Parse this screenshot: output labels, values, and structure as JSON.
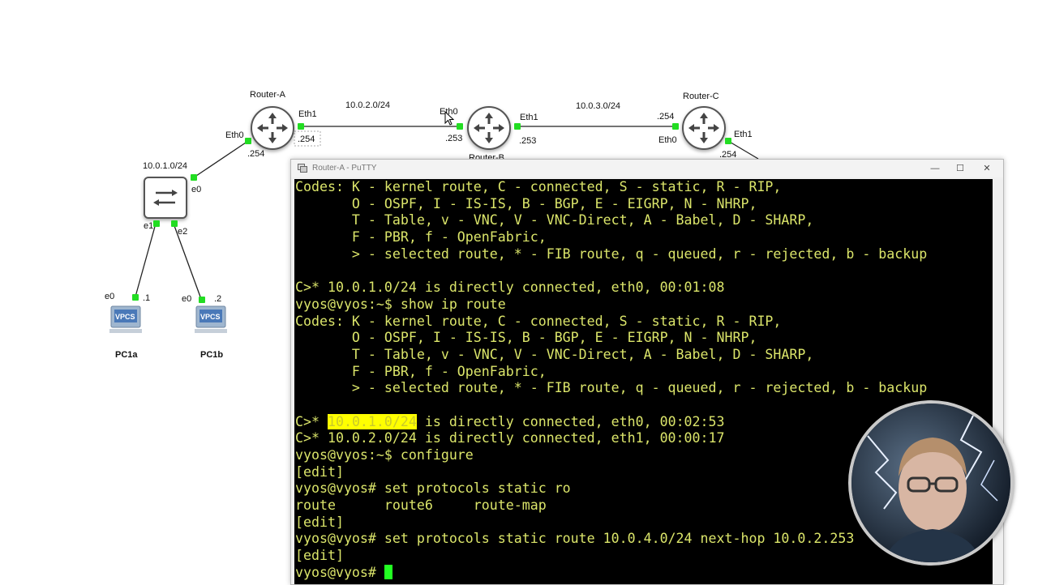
{
  "topology": {
    "routers": [
      {
        "name": "Router-A"
      },
      {
        "name": "Router-B"
      },
      {
        "name": "Router-C"
      }
    ],
    "switch": {
      "name": "switch"
    },
    "pcs": [
      {
        "name": "PC1a",
        "badge": "VPCS"
      },
      {
        "name": "PC1b",
        "badge": "VPCS"
      }
    ],
    "subnets": {
      "net1": "10.0.1.0/24",
      "net2": "10.0.2.0/24",
      "net3": "10.0.3.0/24"
    },
    "interfaces": {
      "ra_eth0": "Eth0",
      "ra_eth1": "Eth1",
      "ra_254a": ".254",
      "ra_254b": ".254",
      "rb_eth0": "Eth0",
      "rb_eth1": "Eth1",
      "rb_253a": ".253",
      "rb_253b": ".253",
      "rc_254": ".254",
      "rc_eth0": "Eth0",
      "rc_eth1": "Eth1",
      "rc_254b": ".254",
      "sw_e0": "e0",
      "sw_e1": "e1",
      "sw_e2": "e2",
      "pc1a_e0": "e0",
      "pc1a_ip": ".1",
      "pc1b_e0": "e0",
      "pc1b_ip": ".2"
    },
    "link_color": "#222222",
    "port_color": "#22dd22"
  },
  "putty": {
    "title": "Router-A - PuTTY",
    "controls": {
      "minimize": "—",
      "maximize": "☐",
      "close": "✕"
    },
    "text_color": "#dbe56a",
    "background": "#000000",
    "lines": [
      "Codes: K - kernel route, C - connected, S - static, R - RIP,",
      "       O - OSPF, I - IS-IS, B - BGP, E - EIGRP, N - NHRP,",
      "       T - Table, v - VNC, V - VNC-Direct, A - Babel, D - SHARP,",
      "       F - PBR, f - OpenFabric,",
      "       > - selected route, * - FIB route, q - queued, r - rejected, b - backup",
      "",
      "C>* 10.0.1.0/24 is directly connected, eth0, 00:01:08",
      "vyos@vyos:~$ show ip route",
      "Codes: K - kernel route, C - connected, S - static, R - RIP,",
      "       O - OSPF, I - IS-IS, B - BGP, E - EIGRP, N - NHRP,",
      "       T - Table, v - VNC, V - VNC-Direct, A - Babel, D - SHARP,",
      "       F - PBR, f - OpenFabric,",
      "       > - selected route, * - FIB route, q - queued, r - rejected, b - backup",
      ""
    ],
    "hl_line": {
      "pre": "C>* ",
      "hl": "10.0.1.0/24",
      "post": " is directly connected, eth0, 00:02:53"
    },
    "lines2": [
      "C>* 10.0.2.0/24 is directly connected, eth1, 00:00:17",
      "vyos@vyos:~$ configure",
      "[edit]",
      "vyos@vyos# set protocols static ro",
      "route      route6     route-map",
      "[edit]",
      "vyos@vyos# set protocols static route 10.0.4.0/24 next-hop 10.0.2.253",
      "[edit]"
    ],
    "prompt": "vyos@vyos# "
  }
}
